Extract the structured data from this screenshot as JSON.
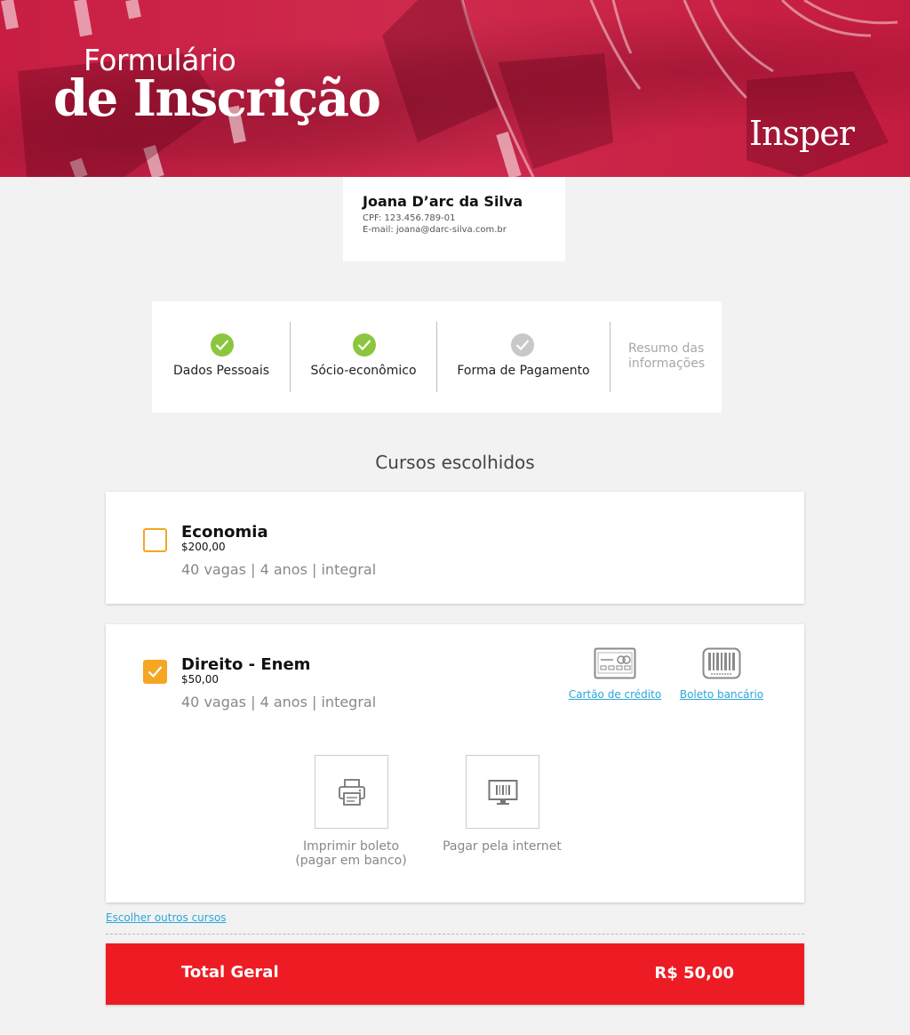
{
  "header": {
    "title_line1": "Formulário",
    "title_line2": "de Inscrição",
    "brand": "Insper",
    "background_color": "#c81e43"
  },
  "user": {
    "name": "Joana D’arc da Silva",
    "cpf": "CPF: 123.456.789-01",
    "email": "E-mail: joana@darc-silva.com.br"
  },
  "steps": [
    {
      "label": "Dados Pessoais",
      "status": "done",
      "color": "#8cc63f"
    },
    {
      "label": "Sócio-econômico",
      "status": "done",
      "color": "#8cc63f"
    },
    {
      "label": "Forma de Pagamento",
      "status": "current",
      "color": "#c8c8c8"
    },
    {
      "label": "Resumo das informações",
      "status": "pending"
    }
  ],
  "section_title": "Cursos escolhidos",
  "courses": [
    {
      "name": "Economia",
      "price": "$200,00",
      "info": "40 vagas | 4 anos | integral",
      "checked": false
    },
    {
      "name": "Direito - Enem",
      "price": "$50,00",
      "info": "40 vagas | 4 anos | integral",
      "checked": true,
      "payment_options": [
        {
          "label": "Cartão de crédito",
          "icon": "credit-card-icon"
        },
        {
          "label": "Boleto bancário",
          "icon": "barcode-icon"
        }
      ],
      "boleto_options": [
        {
          "label_line1": "Imprimir boleto",
          "label_line2": "(pagar em banco)",
          "icon": "printer-icon"
        },
        {
          "label_line1": "Pagar pela internet",
          "label_line2": "",
          "icon": "monitor-barcode-icon"
        }
      ]
    }
  ],
  "other_courses_link": "Escolher outros cursos",
  "total": {
    "label": "Total Geral",
    "value": "R$ 50,00",
    "color": "#ed1c24"
  },
  "colors": {
    "accent_orange": "#f5a623",
    "link_blue": "#2aa6d8",
    "check_green": "#8cc63f"
  }
}
